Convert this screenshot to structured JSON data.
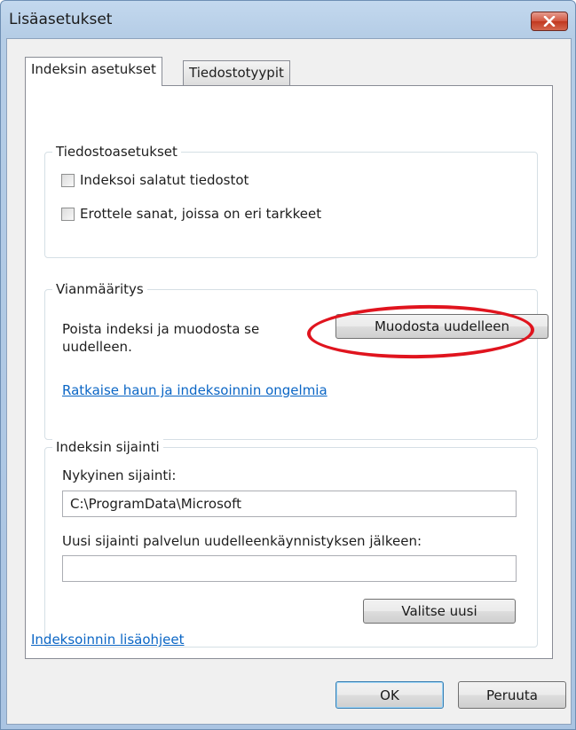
{
  "window": {
    "title": "Lisäasetukset",
    "close_icon": "close-icon"
  },
  "tabs": [
    {
      "label": "Indeksin asetukset",
      "active": true
    },
    {
      "label": "Tiedostotyypit",
      "active": false
    }
  ],
  "file_settings": {
    "legend": "Tiedostoasetukset",
    "options": [
      {
        "label": "Indeksoi salatut tiedostot",
        "checked": false
      },
      {
        "label": "Erottele sanat, joissa on eri tarkkeet",
        "checked": false
      }
    ]
  },
  "troubleshooting": {
    "legend": "Vianmääritys",
    "description": "Poista indeksi ja muodosta se uudelleen.",
    "rebuild_button": "Muodosta uudelleen",
    "link": "Ratkaise haun ja indeksoinnin ongelmia",
    "highlight_color": "#e0141e"
  },
  "index_location": {
    "legend": "Indeksin sijainti",
    "current_label": "Nykyinen sijainti:",
    "current_value": "C:\\ProgramData\\Microsoft",
    "new_label": "Uusi sijainti palvelun uudelleenkäynnistyksen jälkeen:",
    "new_value": "",
    "select_button": "Valitse uusi"
  },
  "help_link": "Indeksoinnin lisäohjeet",
  "footer": {
    "ok": "OK",
    "cancel": "Peruuta"
  },
  "colors": {
    "link": "#0b66c5",
    "titlebar": "#b5cde6",
    "close_button": "#c1381f"
  }
}
